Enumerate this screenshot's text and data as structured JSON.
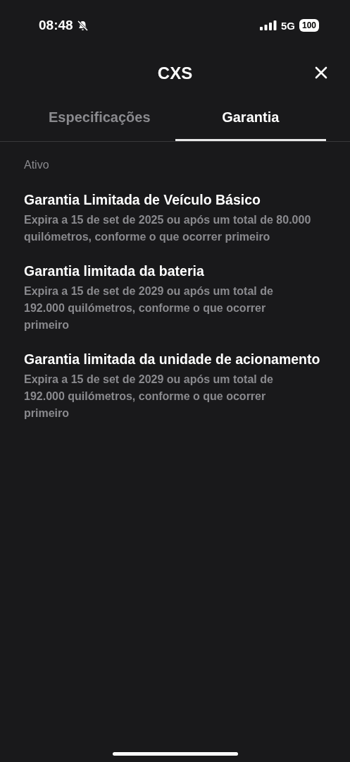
{
  "status_bar": {
    "time": "08:48",
    "network": "5G",
    "battery": "100"
  },
  "header": {
    "title": "CXS"
  },
  "tabs": [
    {
      "label": "Especificações",
      "selected": false
    },
    {
      "label": "Garantia",
      "selected": true
    }
  ],
  "section": {
    "heading": "Ativo"
  },
  "warranties": [
    {
      "title": "Garantia Limitada de Veículo Básico",
      "description": "Expira a 15 de set de 2025 ou após um total de 80.000 quilómetros, conforme o que ocorrer primeiro"
    },
    {
      "title": "Garantia limitada da bateria",
      "description": "Expira a 15 de set de 2029 ou após um total de 192.000 quilómetros, conforme o que ocorrer primeiro"
    },
    {
      "title": "Garantia limitada da unidade de acionamento",
      "description": "Expira a 15 de set de 2029 ou após um total de 192.000 quilómetros, conforme o que ocorrer primeiro"
    }
  ]
}
